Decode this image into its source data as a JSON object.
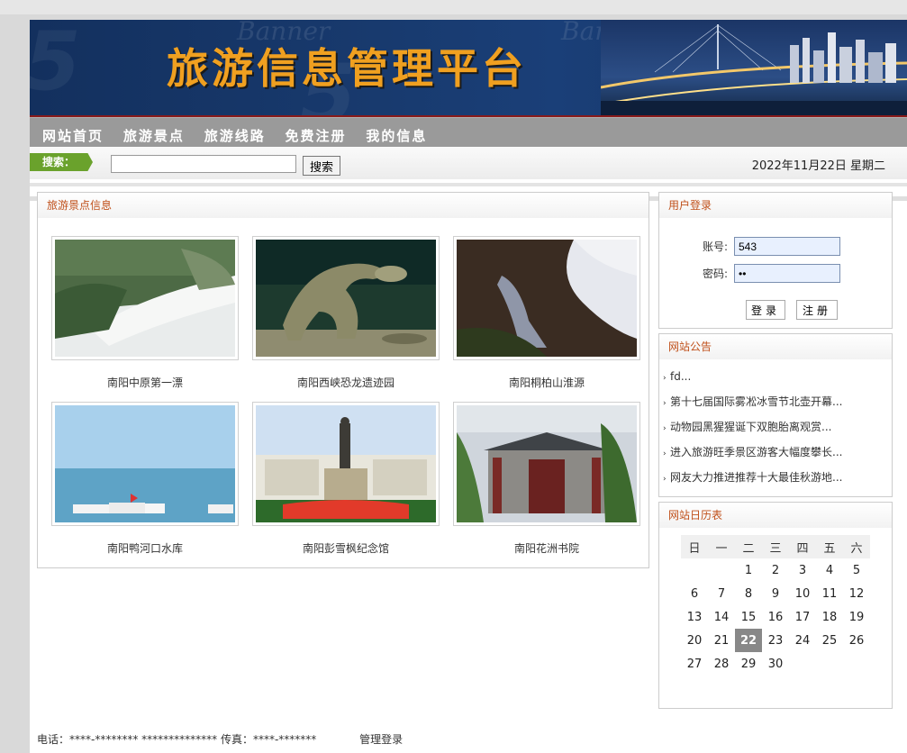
{
  "banner": {
    "title": "旅游信息管理平台",
    "bg_word_1": "Banner",
    "bg_word_2": "Banner"
  },
  "nav": {
    "items": [
      "网站首页",
      "旅游景点",
      "旅游线路",
      "免费注册",
      "我的信息"
    ]
  },
  "search": {
    "label": "搜索：",
    "value": "",
    "button": "搜索"
  },
  "date": "2022年11月22日 星期二",
  "attractions": {
    "title": "旅游景点信息",
    "items": [
      {
        "name": "南阳中原第一漂"
      },
      {
        "name": "南阳西峡恐龙遗迹园"
      },
      {
        "name": "南阳桐柏山淮源"
      },
      {
        "name": "南阳鸭河口水库"
      },
      {
        "name": "南阳彭雪枫纪念馆"
      },
      {
        "name": "南阳花洲书院"
      }
    ]
  },
  "login": {
    "title": "用户登录",
    "account_label": "账号:",
    "account_value": "543",
    "password_label": "密码:",
    "password_value": "••",
    "login_button": "登录",
    "register_button": "注册"
  },
  "notices": {
    "title": "网站公告",
    "items": [
      "fd...",
      "第十七届国际雾凇冰雪节北壶开幕...",
      "动物园黑猩猩诞下双胞胎离观赏...",
      "进入旅游旺季景区游客大幅度攀长...",
      "网友大力推进推荐十大最佳秋游地..."
    ]
  },
  "calendar": {
    "title": "网站日历表",
    "weekdays": [
      "日",
      "一",
      "二",
      "三",
      "四",
      "五",
      "六"
    ],
    "weeks": [
      [
        "",
        "",
        "1",
        "2",
        "3",
        "4",
        "5"
      ],
      [
        "6",
        "7",
        "8",
        "9",
        "10",
        "11",
        "12"
      ],
      [
        "13",
        "14",
        "15",
        "16",
        "17",
        "18",
        "19"
      ],
      [
        "20",
        "21",
        "22",
        "23",
        "24",
        "25",
        "26"
      ],
      [
        "27",
        "28",
        "29",
        "30",
        "",
        "",
        ""
      ]
    ],
    "today": "22"
  },
  "footer": {
    "phone": "电话：****-******** ************** 传真：****-*******",
    "admin_link": "管理登录"
  },
  "colors": {
    "banner_title": "#f0a020",
    "nav_bg": "#9a9a9a",
    "search_tag": "#6aa22c",
    "panel_title": "#c0501a",
    "today_bg": "#888888"
  }
}
